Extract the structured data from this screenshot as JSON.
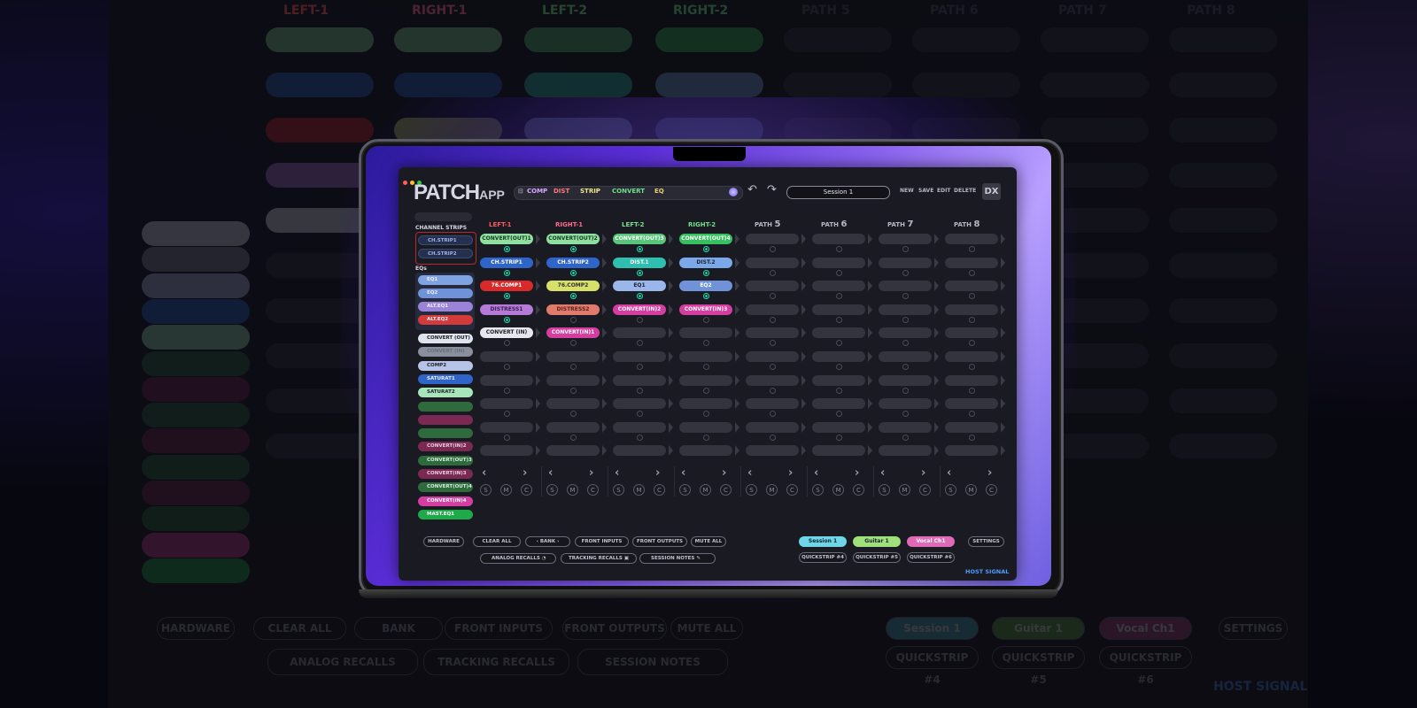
{
  "app": {
    "logo_main": "PATCH",
    "logo_sub": "APP",
    "dx_label": "DX"
  },
  "toolbar": {
    "items": [
      "COMP",
      "DIST",
      "STRIP",
      "CONVERT",
      "EQ"
    ],
    "item_colors": [
      "#d9a7ff",
      "#ff7a7a",
      "#e8e88a",
      "#6ee08c",
      "#e6d27a"
    ]
  },
  "session": {
    "name": "Session 1"
  },
  "menu": {
    "new": "NEW",
    "save": "SAVE",
    "edit": "EDIT",
    "delete": "DELETE"
  },
  "sidebar": {
    "section_channel": "CHANNEL STRIPS",
    "section_eq": "EQs",
    "channel_items": [
      "CH.STRIP1",
      "CH.STRIP2"
    ],
    "eq_items": [
      {
        "label": "EQ1",
        "color": "#7fa3e0"
      },
      {
        "label": "EQ2",
        "color": "#6f92d8"
      },
      {
        "label": "ALT.EQ1",
        "color": "#9b84d8"
      },
      {
        "label": "ALT.EQ2",
        "color": "#d33a3a"
      }
    ],
    "items": [
      {
        "label": "CONVERT (OUT)",
        "color": "#dfe3ee",
        "text": "#222"
      },
      {
        "label": "CONVERT (IN)",
        "color": "#8a8f9e",
        "text": "#6a6e7a"
      },
      {
        "label": "COMP2",
        "color": "#b6c4e8",
        "text": "#222"
      },
      {
        "label": "SATURAT1",
        "color": "#2f64c8",
        "text": "#eef"
      },
      {
        "label": "SATURAT2",
        "color": "#a6e6b8",
        "text": "#223"
      },
      {
        "label": "",
        "color": "#2f6a3c",
        "text": "#cde"
      },
      {
        "label": "",
        "color": "#7a2a52",
        "text": "#cde"
      },
      {
        "label": "",
        "color": "#2f6a3c",
        "text": "#cde"
      },
      {
        "label": "CONVERT(IN)2",
        "color": "#7a2a52",
        "text": "#e9cde0"
      },
      {
        "label": "CONVERT(OUT)3",
        "color": "#2f6a3c",
        "text": "#d3f0da"
      },
      {
        "label": "CONVERT(IN)3",
        "color": "#7a2a52",
        "text": "#e9cde0"
      },
      {
        "label": "CONVERT(OUT)4",
        "color": "#2f6a3c",
        "text": "#d3f0da"
      },
      {
        "label": "CONVERT(IN)4",
        "color": "#d63da0",
        "text": "#fff"
      },
      {
        "label": "MAST.EQ1",
        "color": "#1faa4a",
        "text": "#fff"
      }
    ]
  },
  "columns": [
    {
      "label": "LEFT-1",
      "num": "",
      "color": "#ff5b5b"
    },
    {
      "label": "RIGHT-1",
      "num": "",
      "color": "#ff6a8a"
    },
    {
      "label": "LEFT-2",
      "num": "",
      "color": "#7ce08a"
    },
    {
      "label": "RIGHT-2",
      "num": "",
      "color": "#6fe08a"
    },
    {
      "label": "PATH ",
      "num": "5",
      "color": "#b7b7c5"
    },
    {
      "label": "PATH ",
      "num": "6",
      "color": "#b7b7c5"
    },
    {
      "label": "PATH ",
      "num": "7",
      "color": "#b7b7c5"
    },
    {
      "label": "PATH ",
      "num": "8",
      "color": "#b7b7c5"
    }
  ],
  "grid": [
    [
      {
        "l": "CONVERT(OUT)1",
        "c": "#8fe0a0",
        "t": "#1a3a22"
      },
      {
        "l": "CONVERT(OUT)2",
        "c": "#8fe0a0",
        "t": "#1a3a22"
      },
      {
        "l": "CONVERT(OUT)3",
        "c": "#58c57a",
        "t": "#fff"
      },
      {
        "l": "CONVERT(OUT)4",
        "c": "#36c060",
        "t": "#fff"
      }
    ],
    [
      {
        "l": "CH.STRIP1",
        "c": "#2f64c8",
        "t": "#fff"
      },
      {
        "l": "CH.STRIP2",
        "c": "#2f64c8",
        "t": "#fff"
      },
      {
        "l": "DIST.1",
        "c": "#2fbfb0",
        "t": "#fff"
      },
      {
        "l": "DIST.2",
        "c": "#7aa8e8",
        "t": "#223"
      }
    ],
    [
      {
        "l": "76.COMP1",
        "c": "#d82a2a",
        "t": "#fff"
      },
      {
        "l": "76.COMP2",
        "c": "#d8e06a",
        "t": "#333"
      },
      {
        "l": "EQ1",
        "c": "#9ab6ea",
        "t": "#223"
      },
      {
        "l": "EQ2",
        "c": "#6f92d8",
        "t": "#fff"
      }
    ],
    [
      {
        "l": "DISTRESS1",
        "c": "#b57ad8",
        "t": "#3a1f52"
      },
      {
        "l": "DISTRESS2",
        "c": "#e07a6a",
        "t": "#5a2420"
      },
      {
        "l": "CONVERT(IN)2",
        "c": "#d63da0",
        "t": "#fff"
      },
      {
        "l": "CONVERT(IN)3",
        "c": "#d63da0",
        "t": "#fff"
      }
    ],
    [
      {
        "l": "CONVERT (IN)",
        "c": "#e6e8f0",
        "t": "#222"
      },
      {
        "l": "CONVERT(IN)1",
        "c": "#d63da0",
        "t": "#fff"
      }
    ]
  ],
  "rings_on": [
    [
      1,
      1,
      1,
      1
    ],
    [
      1,
      1,
      1,
      1
    ],
    [
      1,
      1,
      1,
      1
    ],
    [
      1,
      0,
      0,
      0
    ]
  ],
  "mute_labels": {
    "s": "S",
    "m": "M",
    "c": "C"
  },
  "footer": {
    "hardware": "HARDWARE",
    "clear_all": "CLEAR ALL",
    "bank": "BANK",
    "front_inputs": "FRONT INPUTS",
    "front_outputs": "FRONT OUTPUTS",
    "mute_all": "MUTE ALL",
    "analog_recalls": "ANALOG RECALLS",
    "tracking_recalls": "TRACKING RECALLS",
    "session_notes": "SESSION NOTES",
    "session1": "Session 1",
    "guitar1": "Guitar 1",
    "vocal": "Vocal Ch1",
    "settings": "SETTINGS",
    "qs4": "QUICKSTRIP #4",
    "qs5": "QUICKSTRIP #5",
    "qs6": "QUICKSTRIP #6",
    "host_signal": "HOST SIGNAL"
  }
}
